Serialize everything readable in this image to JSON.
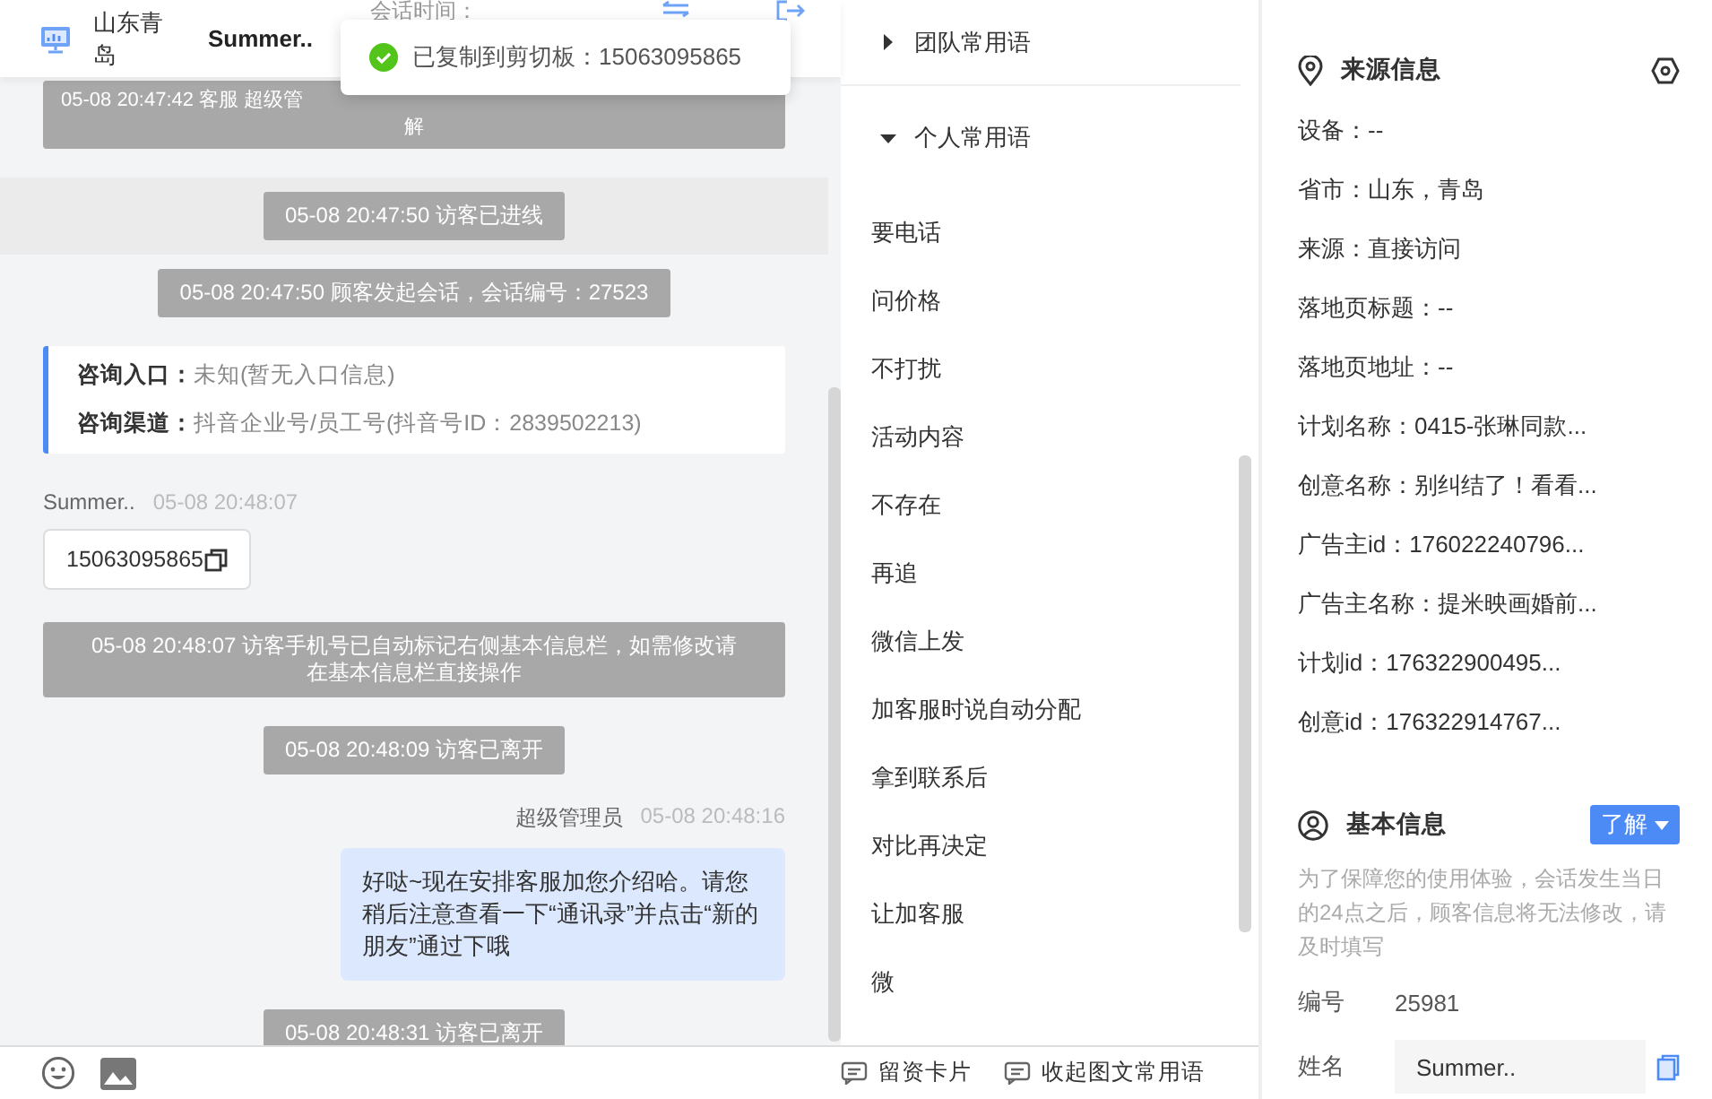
{
  "header": {
    "location": "山东青岛",
    "name": "Summer..",
    "session_label": "会话时间："
  },
  "toast": {
    "text": "已复制到剪切板：15063095865"
  },
  "messages": [
    {
      "kind": "system",
      "lines": [
        "05-08 20:47:42 客服 超级管",
        "解"
      ],
      "highlighted": false
    },
    {
      "kind": "system",
      "lines": [
        "05-08 20:47:50 访客已进线"
      ],
      "highlighted": true
    },
    {
      "kind": "system",
      "lines": [
        "05-08 20:47:50 顾客发起会话，会话编号：27523"
      ],
      "highlighted": false
    },
    {
      "kind": "info",
      "rows": [
        {
          "label": "咨询入口：",
          "value": "未知(暂无入口信息)"
        },
        {
          "label": "咨询渠道：",
          "value": "抖音企业号/员工号(抖音号ID：2839502213)"
        }
      ]
    },
    {
      "kind": "visitor",
      "name": "Summer..",
      "time": "05-08 20:48:07",
      "text": "15063095865"
    },
    {
      "kind": "system",
      "lines": [
        "05-08 20:48:07 访客手机号已自动标记右侧基本信息栏，如需修改请",
        "在基本信息栏直接操作"
      ],
      "highlighted": false
    },
    {
      "kind": "system",
      "lines": [
        "05-08 20:48:09 访客已离开"
      ],
      "highlighted": false
    },
    {
      "kind": "agent",
      "name": "超级管理员",
      "time": "05-08 20:48:16",
      "text": "好哒~现在安排客服加您介绍哈。请您稍后注意查看一下“通讯录”并点击“新的朋友”通过下哦"
    },
    {
      "kind": "system",
      "lines": [
        "05-08 20:48:31 访客已离开"
      ],
      "highlighted": false
    }
  ],
  "phrases": {
    "groups": [
      {
        "label": "团队常用语",
        "expanded": false
      },
      {
        "label": "个人常用语",
        "expanded": true
      }
    ],
    "items": [
      "要电话",
      "问价格",
      "不打扰",
      "活动内容",
      "不存在",
      "再追",
      "微信上发",
      "加客服时说自动分配",
      "拿到联系后",
      "对比再决定",
      "让加客服",
      "微"
    ],
    "footer": [
      "留资卡片",
      "收起图文常用语"
    ]
  },
  "source": {
    "title": "来源信息",
    "rows": [
      "设备：--",
      "省市：山东，青岛",
      "来源：直接访问",
      "落地页标题：--",
      "落地页地址：--",
      "计划名称：0415-张琳同款...",
      "创意名称：别纠结了！看看...",
      "广告主id：176022240796...",
      "广告主名称：提米映画婚前...",
      "计划id：176322900495...",
      "创意id：176322914767..."
    ]
  },
  "basic": {
    "title": "基本信息",
    "button": "了解",
    "note": "为了保障您的使用体验，会话发生当日的24点之后，顾客信息将无法修改，请及时填写",
    "fields": [
      {
        "kind": "text",
        "label": "编号",
        "value": "25981"
      },
      {
        "kind": "input",
        "label": "姓名",
        "value": "Summer.."
      }
    ]
  }
}
